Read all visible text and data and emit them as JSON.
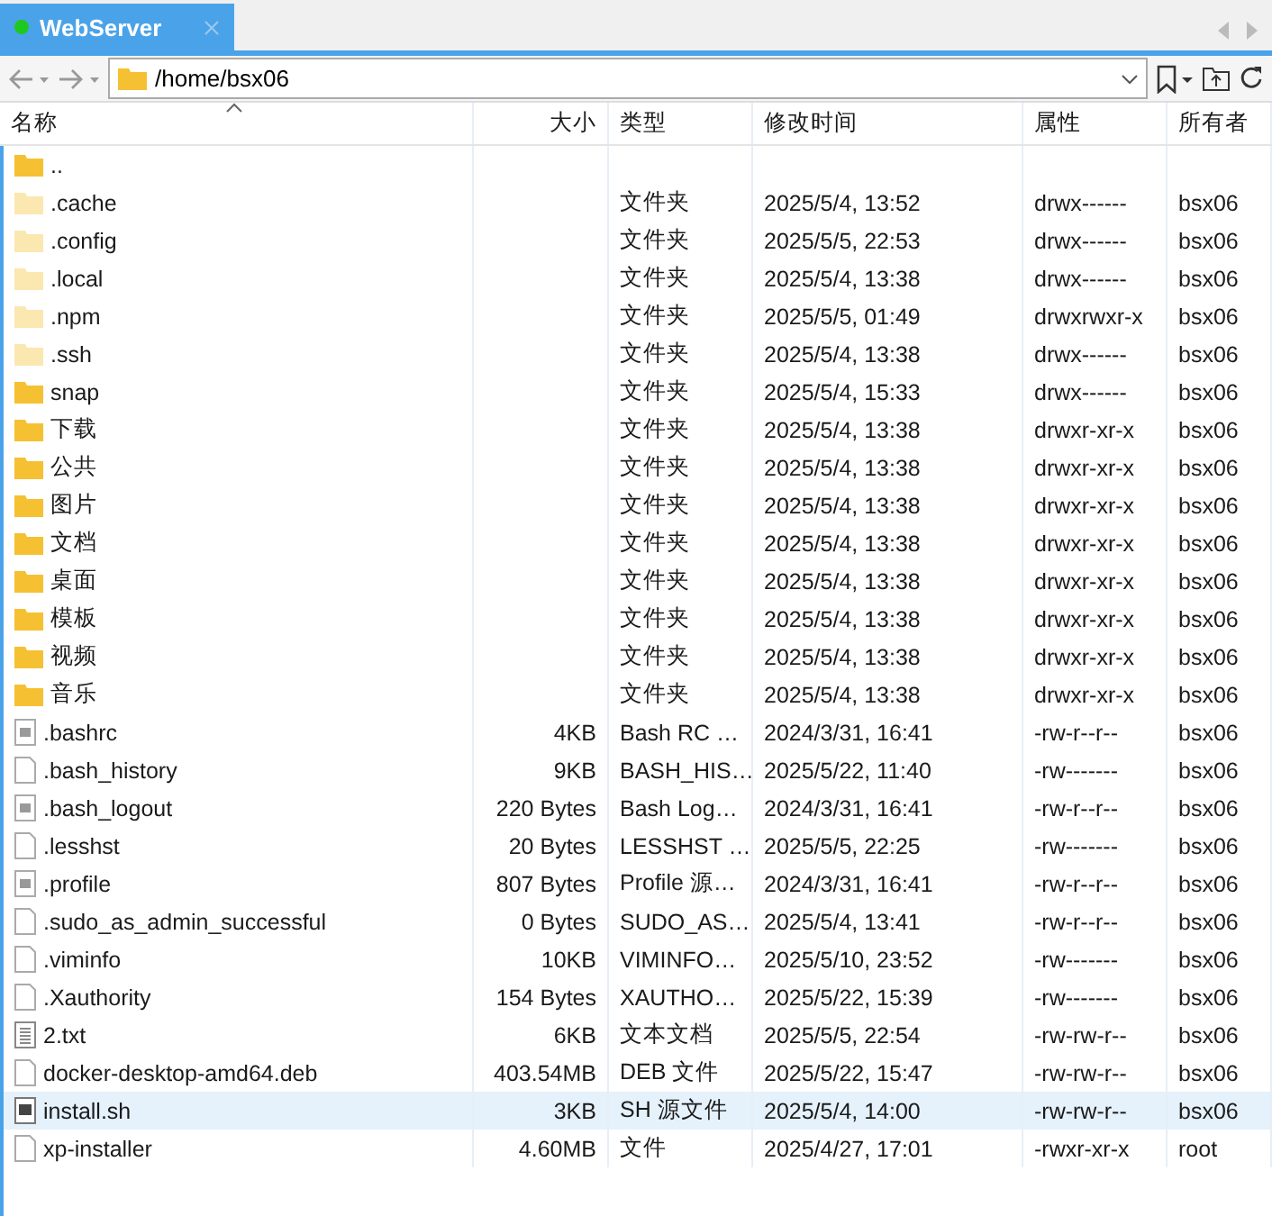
{
  "tabs": [
    {
      "label": "WebServer",
      "selected": true
    }
  ],
  "address": {
    "value": "/home/bsx06"
  },
  "table": {
    "columns": [
      {
        "label": "名称",
        "sorted": true
      },
      {
        "label": "大小",
        "sorted": false
      },
      {
        "label": "类型",
        "sorted": false
      },
      {
        "label": "修改时间",
        "sorted": false
      },
      {
        "label": "属性",
        "sorted": false
      },
      {
        "label": "所有者",
        "sorted": false
      }
    ],
    "rows": [
      {
        "kind": "folder",
        "name": "..",
        "selected": false
      },
      {
        "kind": "hidden_folder",
        "name": ".cache",
        "type": "文件夹",
        "modified": "2025/5/4, 13:52",
        "attributes": "drwx------",
        "owner": "bsx06",
        "selected": false
      },
      {
        "kind": "hidden_folder",
        "name": ".config",
        "type": "文件夹",
        "modified": "2025/5/5, 22:53",
        "attributes": "drwx------",
        "owner": "bsx06",
        "selected": false
      },
      {
        "kind": "hidden_folder",
        "name": ".local",
        "type": "文件夹",
        "modified": "2025/5/4, 13:38",
        "attributes": "drwx------",
        "owner": "bsx06",
        "selected": false
      },
      {
        "kind": "hidden_folder",
        "name": ".npm",
        "type": "文件夹",
        "modified": "2025/5/5, 01:49",
        "attributes": "drwxrwxr-x",
        "owner": "bsx06",
        "selected": false
      },
      {
        "kind": "hidden_folder",
        "name": ".ssh",
        "type": "文件夹",
        "modified": "2025/5/4, 13:38",
        "attributes": "drwx------",
        "owner": "bsx06",
        "selected": false
      },
      {
        "kind": "folder",
        "name": "snap",
        "type": "文件夹",
        "modified": "2025/5/4, 15:33",
        "attributes": "drwx------",
        "owner": "bsx06",
        "selected": false
      },
      {
        "kind": "folder",
        "name": "下载",
        "type": "文件夹",
        "modified": "2025/5/4, 13:38",
        "attributes": "drwxr-xr-x",
        "owner": "bsx06",
        "selected": false
      },
      {
        "kind": "folder",
        "name": "公共",
        "type": "文件夹",
        "modified": "2025/5/4, 13:38",
        "attributes": "drwxr-xr-x",
        "owner": "bsx06",
        "selected": false
      },
      {
        "kind": "folder",
        "name": "图片",
        "type": "文件夹",
        "modified": "2025/5/4, 13:38",
        "attributes": "drwxr-xr-x",
        "owner": "bsx06",
        "selected": false
      },
      {
        "kind": "folder",
        "name": "文档",
        "type": "文件夹",
        "modified": "2025/5/4, 13:38",
        "attributes": "drwxr-xr-x",
        "owner": "bsx06",
        "selected": false
      },
      {
        "kind": "folder",
        "name": "桌面",
        "type": "文件夹",
        "modified": "2025/5/4, 13:38",
        "attributes": "drwxr-xr-x",
        "owner": "bsx06",
        "selected": false
      },
      {
        "kind": "folder",
        "name": "模板",
        "type": "文件夹",
        "modified": "2025/5/4, 13:38",
        "attributes": "drwxr-xr-x",
        "owner": "bsx06",
        "selected": false
      },
      {
        "kind": "folder",
        "name": "视频",
        "type": "文件夹",
        "modified": "2025/5/4, 13:38",
        "attributes": "drwxr-xr-x",
        "owner": "bsx06",
        "selected": false
      },
      {
        "kind": "folder",
        "name": "音乐",
        "type": "文件夹",
        "modified": "2025/5/4, 13:38",
        "attributes": "drwxr-xr-x",
        "owner": "bsx06",
        "selected": false
      },
      {
        "kind": "config_file",
        "name": ".bashrc",
        "size": "4KB",
        "type": "Bash RC …",
        "modified": "2024/3/31, 16:41",
        "attributes": "-rw-r--r--",
        "owner": "bsx06",
        "selected": false
      },
      {
        "kind": "file",
        "name": ".bash_history",
        "size": "9KB",
        "type": "BASH_HIS…",
        "modified": "2025/5/22, 11:40",
        "attributes": "-rw-------",
        "owner": "bsx06",
        "selected": false
      },
      {
        "kind": "config_file",
        "name": ".bash_logout",
        "size": "220 Bytes",
        "type": "Bash Log…",
        "modified": "2024/3/31, 16:41",
        "attributes": "-rw-r--r--",
        "owner": "bsx06",
        "selected": false
      },
      {
        "kind": "file",
        "name": ".lesshst",
        "size": "20 Bytes",
        "type": "LESSHST …",
        "modified": "2025/5/5, 22:25",
        "attributes": "-rw-------",
        "owner": "bsx06",
        "selected": false
      },
      {
        "kind": "config_file",
        "name": ".profile",
        "size": "807 Bytes",
        "type": "Profile 源…",
        "modified": "2024/3/31, 16:41",
        "attributes": "-rw-r--r--",
        "owner": "bsx06",
        "selected": false
      },
      {
        "kind": "file",
        "name": ".sudo_as_admin_successful",
        "size": "0 Bytes",
        "type": "SUDO_AS…",
        "modified": "2025/5/4, 13:41",
        "attributes": "-rw-r--r--",
        "owner": "bsx06",
        "selected": false
      },
      {
        "kind": "file",
        "name": ".viminfo",
        "size": "10KB",
        "type": "VIMINFO…",
        "modified": "2025/5/10, 23:52",
        "attributes": "-rw-------",
        "owner": "bsx06",
        "selected": false
      },
      {
        "kind": "file",
        "name": ".Xauthority",
        "size": "154 Bytes",
        "type": "XAUTHO…",
        "modified": "2025/5/22, 15:39",
        "attributes": "-rw-------",
        "owner": "bsx06",
        "selected": false
      },
      {
        "kind": "text_file",
        "name": "2.txt",
        "size": "6KB",
        "type": "文本文档",
        "modified": "2025/5/5, 22:54",
        "attributes": "-rw-rw-r--",
        "owner": "bsx06",
        "selected": false
      },
      {
        "kind": "file",
        "name": "docker-desktop-amd64.deb",
        "size": "403.54MB",
        "type": "DEB 文件",
        "modified": "2025/5/22, 15:47",
        "attributes": "-rw-rw-r--",
        "owner": "bsx06",
        "selected": false
      },
      {
        "kind": "script_file",
        "name": "install.sh",
        "size": "3KB",
        "type": "SH 源文件",
        "modified": "2025/5/4, 14:00",
        "attributes": "-rw-rw-r--",
        "owner": "bsx06",
        "selected": true
      },
      {
        "kind": "file",
        "name": "xp-installer",
        "size": "4.60MB",
        "type": "文件",
        "modified": "2025/4/27, 17:01",
        "attributes": "-rwxr-xr-x",
        "owner": "root",
        "selected": false
      }
    ]
  }
}
